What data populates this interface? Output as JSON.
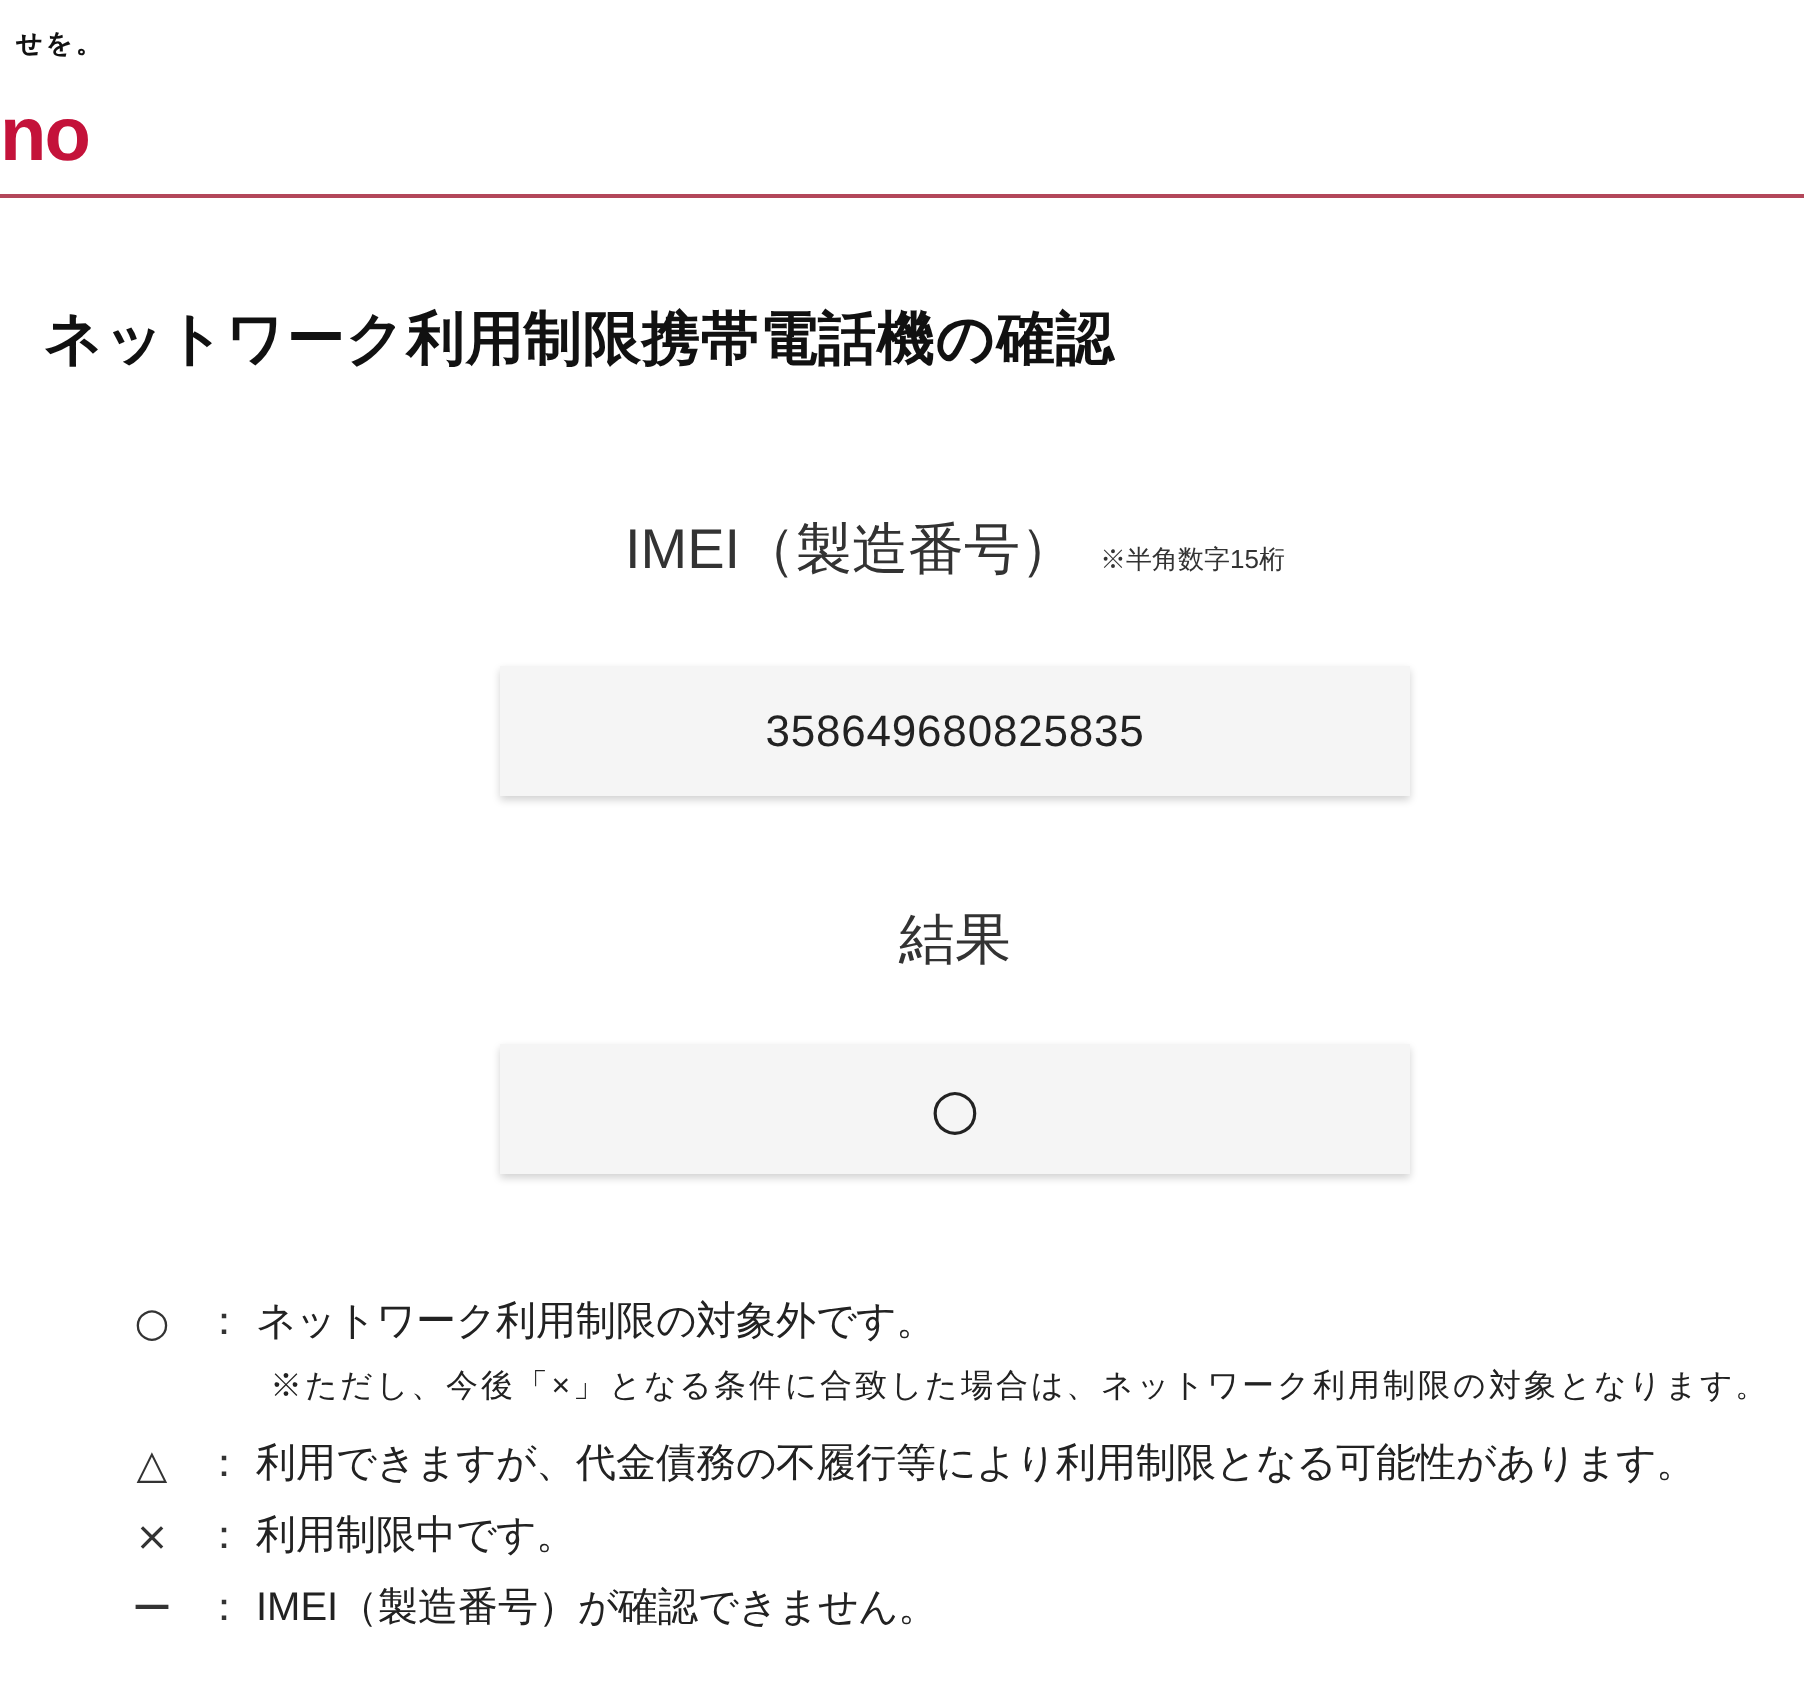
{
  "header": {
    "tagline": "せを。",
    "logo": "no"
  },
  "page_title": "ネットワーク利用制限携帯電話機の確認",
  "imei": {
    "label": "IMEI（製造番号）",
    "note": "※半角数字15桁",
    "value": "358649680825835"
  },
  "result": {
    "label": "結果",
    "value": "○"
  },
  "legend": [
    {
      "symbol": "○",
      "colon": "：",
      "text": "ネットワーク利用制限の対象外です。",
      "note": "※ただし、今後「×」となる条件に合致した場合は、ネットワーク利用制限の対象となります。"
    },
    {
      "symbol": "△",
      "colon": "：",
      "text": "利用できますが、代金債務の不履行等により利用制限となる可能性があります。"
    },
    {
      "symbol": "×",
      "colon": "：",
      "text": "利用制限中です。"
    },
    {
      "symbol": "ー",
      "colon": "：",
      "text": "IMEI（製造番号）が確認できません。"
    }
  ]
}
